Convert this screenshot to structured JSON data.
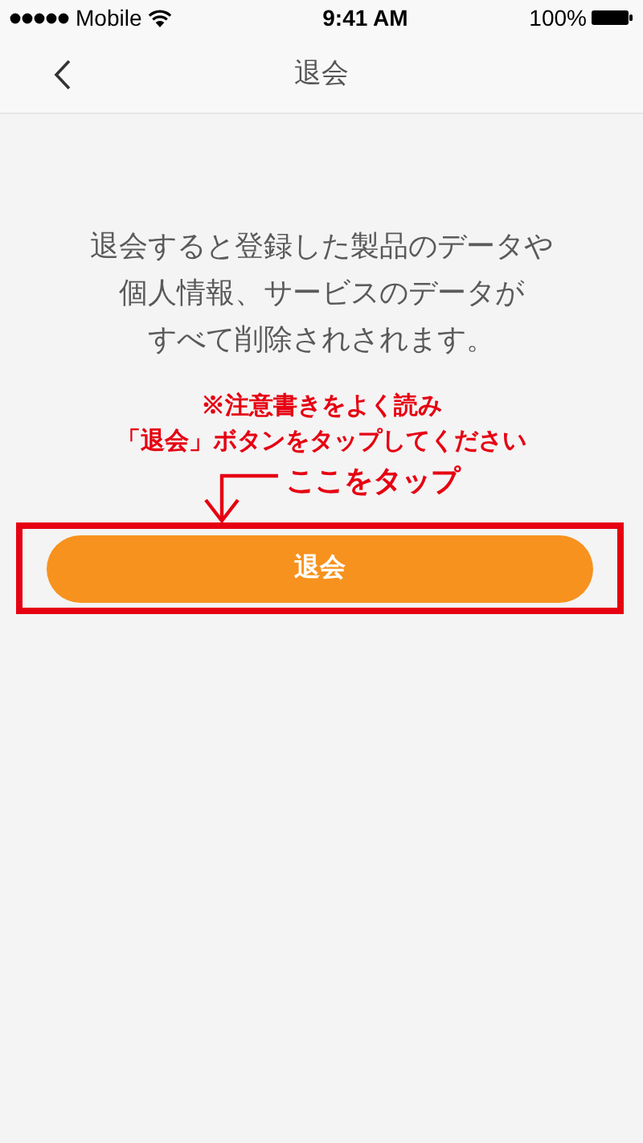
{
  "status_bar": {
    "carrier": "Mobile",
    "time": "9:41 AM",
    "battery": "100%"
  },
  "nav_bar": {
    "title": "退会"
  },
  "description": [
    "退会すると登録した製品のデータや",
    "個人情報、サービスのデータが",
    "すべて削除されされます。"
  ],
  "annotation": {
    "note": [
      "※注意書きをよく読み",
      "「退会」ボタンをタップしてください"
    ],
    "callout": "ここをタップ"
  },
  "button": {
    "label": "退会"
  }
}
